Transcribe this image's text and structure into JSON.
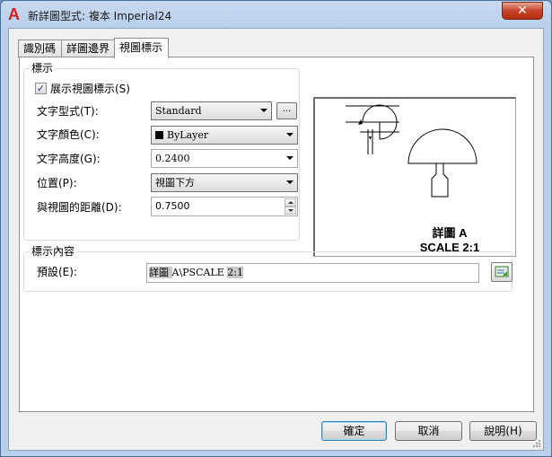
{
  "window": {
    "title": "新詳圖型式: 複本 Imperial24",
    "app_icon": "A",
    "close_glyph": "✕"
  },
  "tabs": [
    {
      "label": "識別碼",
      "active": false
    },
    {
      "label": "詳圖邊界",
      "active": false
    },
    {
      "label": "視圖標示",
      "active": true
    }
  ],
  "label_group": {
    "legend": "標示",
    "show_checkbox": {
      "label": "展示視圖標示(S)",
      "checked": true,
      "check_glyph": "✓"
    },
    "text_style": {
      "label": "文字型式(T):",
      "value": "Standard",
      "browse_label": "..."
    },
    "text_color": {
      "label": "文字顏色(C):",
      "value": "ByLayer"
    },
    "text_height": {
      "label": "文字高度(G):",
      "value": "0.2400"
    },
    "position": {
      "label": "位置(P):",
      "value": "視圖下方"
    },
    "distance": {
      "label": "與視圖的距離(D):",
      "value": "0.7500"
    }
  },
  "preview": {
    "caption_line1": "詳圖 A",
    "caption_line2": "SCALE 2:1"
  },
  "contents_group": {
    "legend": "標示內容",
    "default_label": "預設(E):",
    "default_value_parts": [
      "詳圖 ",
      "A",
      "\\PSCALE ",
      "2:1"
    ],
    "field_button_icon": "insert-field-icon"
  },
  "buttons": {
    "ok": "確定",
    "cancel": "取消",
    "help": "說明(H)"
  }
}
